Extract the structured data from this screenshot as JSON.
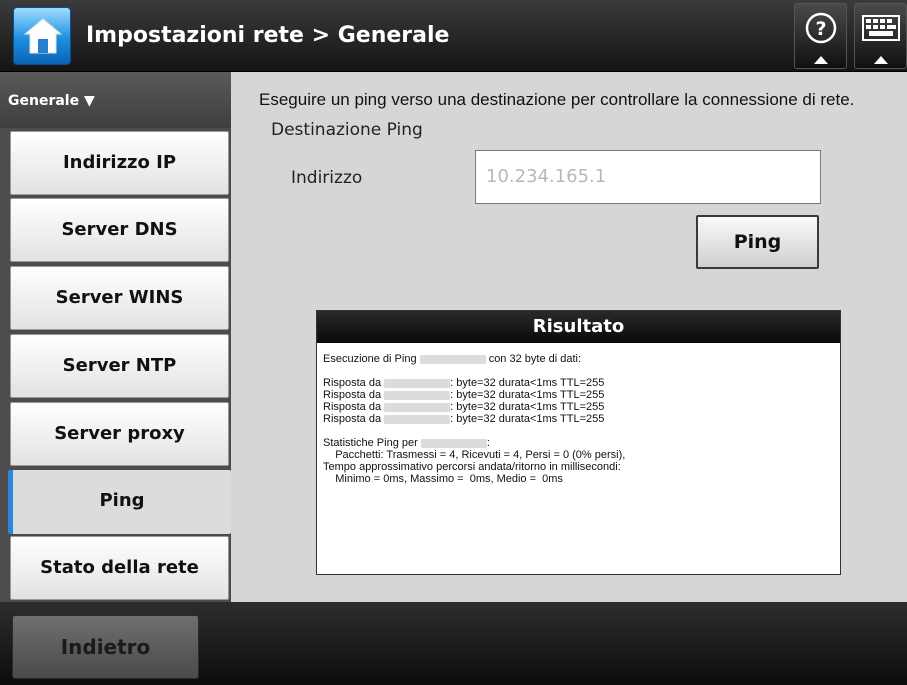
{
  "header": {
    "title": "Impostazioni rete > Generale",
    "home_icon": "home-icon",
    "help_icon": "help-icon",
    "keyboard_icon": "keyboard-icon",
    "accent_color": "#1d8fe0"
  },
  "sidebar": {
    "header_label": "Generale ▼",
    "items": [
      {
        "label": "Indirizzo IP"
      },
      {
        "label": "Server DNS"
      },
      {
        "label": "Server WINS"
      },
      {
        "label": "Server NTP"
      },
      {
        "label": "Server proxy"
      },
      {
        "label": "Ping",
        "active": true
      },
      {
        "label": "Stato della rete"
      }
    ]
  },
  "main": {
    "description": "Eseguire un ping verso una destinazione per controllare la connessione di rete.",
    "section_title": "Destinazione Ping",
    "address_label": "Indirizzo",
    "address_value": "10.234.165.1",
    "ping_button": "Ping"
  },
  "result": {
    "title": "Risultato",
    "exec_prefix": "Esecuzione di Ping",
    "exec_suffix": "con 32 byte di dati:",
    "reply_prefix": "Risposta da",
    "reply_suffix": ": byte=32 durata<1ms TTL=255",
    "stats_prefix": "Statistiche Ping per",
    "stats_suffix": ":",
    "packets": "    Pacchetti: Trasmessi = 4, Ricevuti = 4, Persi = 0 (0% persi),",
    "rtt_title": "Tempo approssimativo percorsi andata/ritorno in millisecondi:",
    "rtt_values": "    Minimo = 0ms, Massimo =  0ms, Medio =  0ms"
  },
  "footer": {
    "back_button": "Indietro"
  }
}
